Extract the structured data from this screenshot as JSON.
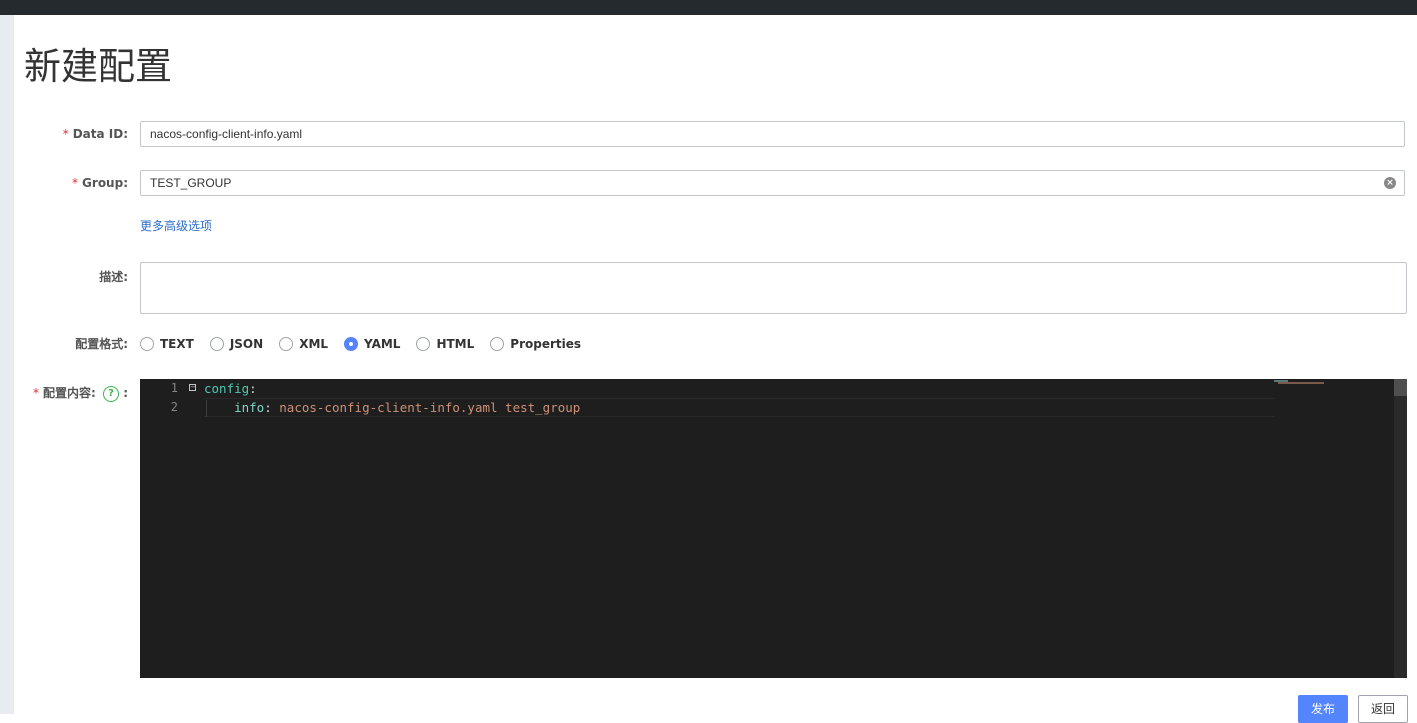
{
  "page": {
    "title": "新建配置"
  },
  "form": {
    "data_id": {
      "label": "Data ID:",
      "value": "nacos-config-client-info.yaml"
    },
    "group": {
      "label": "Group:",
      "value": "TEST_GROUP"
    },
    "advanced_link": "更多高级选项",
    "description": {
      "label": "描述:",
      "value": ""
    },
    "format": {
      "label": "配置格式:",
      "options": [
        "TEXT",
        "JSON",
        "XML",
        "YAML",
        "HTML",
        "Properties"
      ],
      "selected": "YAML"
    },
    "content": {
      "label": "配置内容:",
      "colon": ":",
      "help": "?",
      "lines": [
        {
          "num": "1",
          "key": "config",
          "sep": ":",
          "value": ""
        },
        {
          "num": "2",
          "indent": "    ",
          "key": "info",
          "sep": ": ",
          "value": "nacos-config-client-info.yaml test_group"
        }
      ]
    },
    "required_mark": "*"
  },
  "buttons": {
    "publish": "发布",
    "back": "返回"
  },
  "colors": {
    "primary": "#5584ff",
    "required": "#e72b2b",
    "link": "#2b6ecc",
    "editor_bg": "#1e1e1e"
  }
}
